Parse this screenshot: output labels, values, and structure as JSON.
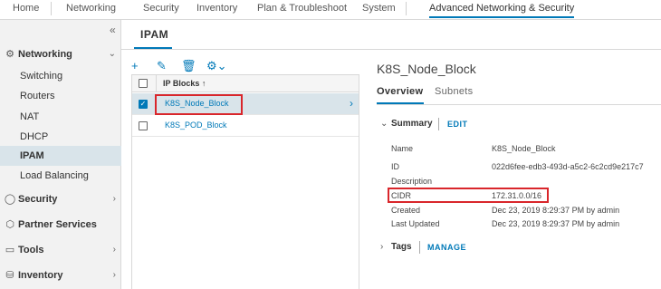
{
  "topnav": {
    "tabs": [
      "Home",
      "Networking",
      "Security",
      "Inventory",
      "Plan & Troubleshoot",
      "System",
      "Advanced Networking & Security"
    ]
  },
  "sidebar": {
    "networking": "Networking",
    "items": [
      "Switching",
      "Routers",
      "NAT",
      "DHCP",
      "IPAM",
      "Load Balancing"
    ],
    "security": "Security",
    "partner": "Partner Services",
    "tools": "Tools",
    "inventory": "Inventory"
  },
  "page": {
    "title": "IPAM"
  },
  "grid": {
    "header": "IP Blocks ↑",
    "rows": [
      "K8S_Node_Block",
      "K8S_POD_Block"
    ]
  },
  "detail": {
    "title": "K8S_Node_Block",
    "tabs": [
      "Overview",
      "Subnets"
    ],
    "summary_label": "Summary",
    "edit_label": "EDIT",
    "fields": [
      {
        "label": "Name",
        "value": "K8S_Node_Block"
      },
      {
        "label": "ID",
        "value": "022d6fee-edb3-493d-a5c2-6c2cd9e217c7"
      },
      {
        "label": "Description",
        "value": ""
      },
      {
        "label": "CIDR",
        "value": "172.31.0.0/16"
      },
      {
        "label": "Created",
        "value": "Dec 23, 2019 8:29:37 PM by admin"
      },
      {
        "label": "Last Updated",
        "value": "Dec 23, 2019 8:29:37 PM by admin"
      }
    ],
    "tags_label": "Tags",
    "manage_label": "MANAGE"
  },
  "colors": {
    "accent": "#0079b8",
    "highlight": "#d9262b",
    "selected": "#d9e4ea"
  }
}
